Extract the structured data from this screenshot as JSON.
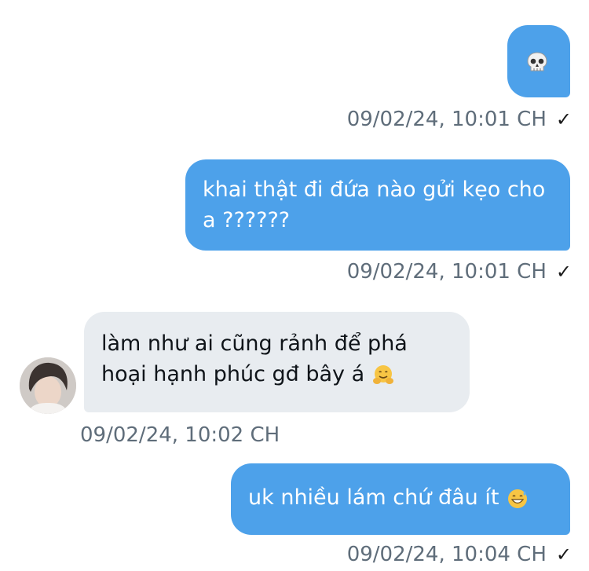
{
  "messages": [
    {
      "text": "",
      "emoji": "skull",
      "time": "09/02/24, 10:01 CH",
      "status": "sent"
    },
    {
      "text": "khai thật đi đứa nào gửi kẹo cho a ??????",
      "time": "09/02/24, 10:01 CH",
      "status": "sent"
    },
    {
      "text": "làm như ai cũng rảnh để phá hoại hạnh phúc gđ bây á",
      "emoji": "hugging-face",
      "time": "09/02/24, 10:02 CH"
    },
    {
      "text": "uk nhiều lám chứ đâu ít",
      "emoji": "grinning-sweat-face",
      "time": "09/02/24, 10:04 CH",
      "status": "sent"
    }
  ],
  "colors": {
    "outgoing_bubble": "#4da1ea",
    "incoming_bubble": "#e8ecf0",
    "timestamp": "#5f6d7a"
  },
  "icons": {
    "read_receipt": "checkmark-icon"
  }
}
